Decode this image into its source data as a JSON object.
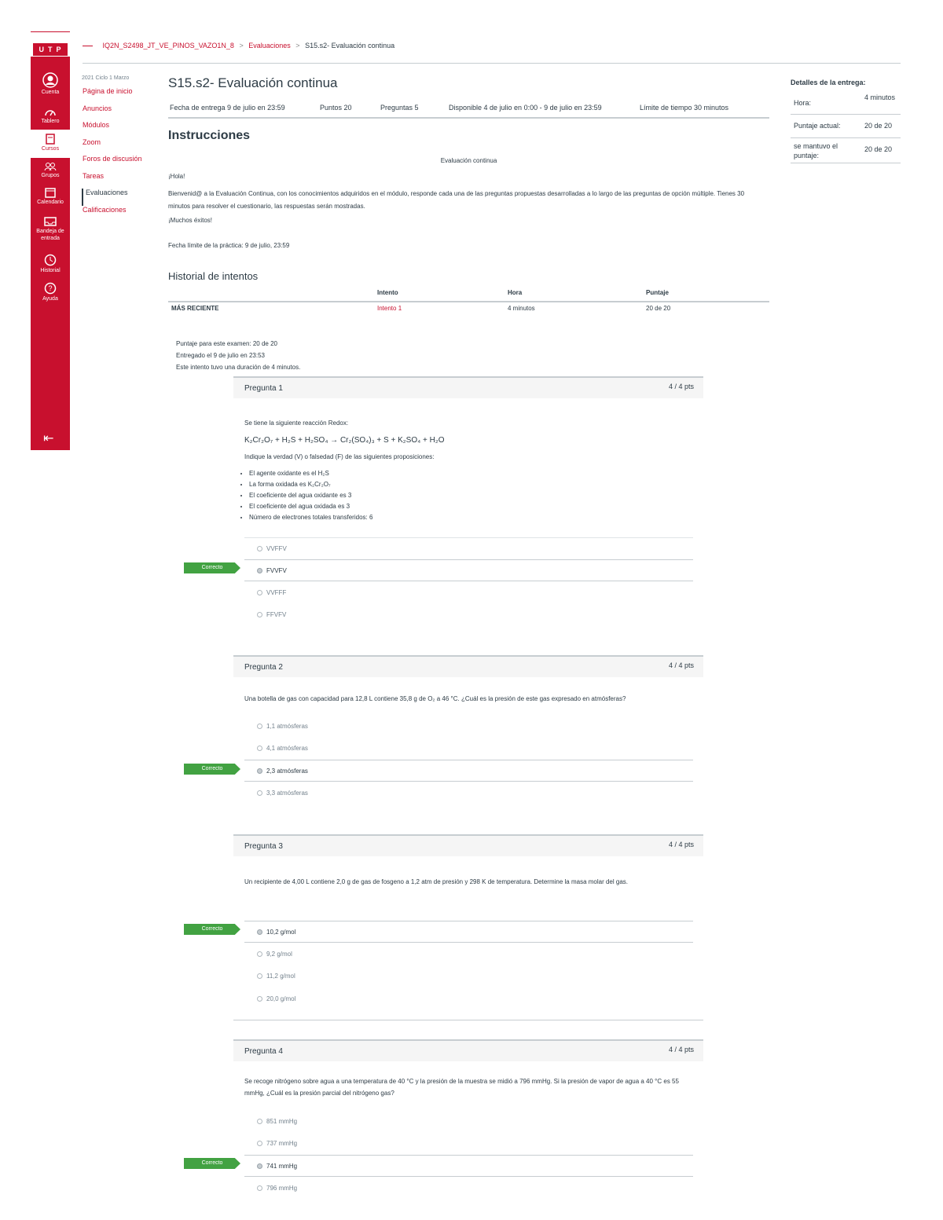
{
  "global_nav": {
    "logo": "UTP",
    "items": [
      {
        "label": "Cuenta",
        "icon": "account-icon"
      },
      {
        "label": "Tablero",
        "icon": "dashboard-icon"
      },
      {
        "label": "Cursos",
        "icon": "courses-icon"
      },
      {
        "label": "Grupos",
        "icon": "groups-icon"
      },
      {
        "label": "Calendario",
        "icon": "calendar-icon"
      },
      {
        "label": "Bandeja de entrada",
        "icon": "inbox-icon"
      },
      {
        "label": "Historial",
        "icon": "history-icon"
      },
      {
        "label": "Ayuda",
        "icon": "help-icon"
      }
    ]
  },
  "breadcrumb": {
    "course": "IQ2N_S2498_JT_VE_PINOS_VAZO1N_8",
    "section": "Evaluaciones",
    "current": "S15.s2- Evaluación continua"
  },
  "course_nav": {
    "term": "2021 Ciclo 1 Marzo",
    "items": [
      "Página de inicio",
      "Anuncios",
      "Módulos",
      "Zoom",
      "Foros de discusión",
      "Tareas",
      "Evaluaciones",
      "Calificaciones"
    ]
  },
  "quiz": {
    "title": "S15.s2- Evaluación continua",
    "meta": {
      "due": "Fecha de entrega 9 de julio en 23:59",
      "points": "Puntos 20",
      "questions": "Preguntas 5",
      "available": "Disponible 4 de julio en 0:00 - 9 de julio en 23:59",
      "time_limit": "Límite de tiempo 30 minutos"
    },
    "instructions_heading": "Instrucciones",
    "instructions_center": "Evaluación continua",
    "instructions_greeting": "¡Hola!",
    "instructions_body": "Bienvenid@ a la Evaluación Continua, con los conocimientos adquiridos en el módulo, responde cada una de las preguntas propuestas desarrolladas a lo largo de las preguntas de opción múltiple. Tienes 30 minutos para resolver el cuestionario, las respuestas serán mostradas.",
    "instructions_thanks": "¡Muchos éxitos!",
    "instructions_due": "Fecha límite de la práctica: 9 de julio, 23:59"
  },
  "history": {
    "heading": "Historial de intentos",
    "columns": [
      "Intento",
      "Hora",
      "Puntaje"
    ],
    "row": {
      "label": "MÁS RECIENTE",
      "attempt": "Intento 1",
      "time": "4 minutos",
      "score": "20 de 20"
    },
    "summary": [
      "Puntaje para este examen: 20 de 20",
      "Entregado el 9 de julio en 23:53",
      "Este intento tuvo una duración de 4 minutos."
    ]
  },
  "sidebar": {
    "title": "Detalles de la entrega:",
    "rows": [
      {
        "label": "Hora:",
        "value": "4 minutos"
      },
      {
        "label": "Puntaje actual:",
        "value": "20 de 20"
      },
      {
        "label": "se mantuvo el puntaje:",
        "value": "20 de 20"
      }
    ]
  },
  "questions": [
    {
      "title": "Pregunta 1",
      "points": "4 / 4 pts",
      "intro": "Se tiene la siguiente reacción Redox:",
      "equation": "K₂Cr₂O₇ + H₂S + H₂SO₄ → Cr₂(SO₄)₃ + S + K₂SO₄ + H₂O",
      "prompt": "Indique la verdad (V) o falsedad (F) de las siguientes proposiciones:",
      "bullets": [
        "El agente oxidante es el H₂S",
        "La forma oxidada es K₂Cr₂O₇",
        "El coeficiente del agua oxidante es 3",
        "El coeficiente del agua oxidada es 3",
        "Número de electrones totales transferidos: 6"
      ],
      "answers": [
        "VVFFV",
        "FVVFV",
        "VVFFF",
        "FFVFV"
      ],
      "selected": 1,
      "flag": "Correcto"
    },
    {
      "title": "Pregunta 2",
      "points": "4 / 4 pts",
      "prompt": "Una botella de gas con capacidad para 12,8 L contiene 35,8 g de O₂ a 46 °C. ¿Cuál es la presión de este gas expresado en atmósferas?",
      "answers": [
        "1,1 atmósferas",
        "4,1 atmósferas",
        "2,3 atmósferas",
        "3,3 atmósferas"
      ],
      "selected": 2,
      "flag": "Correcto"
    },
    {
      "title": "Pregunta 3",
      "points": "4 / 4 pts",
      "prompt": "Un recipiente de 4,00 L contiene 2,0 g de gas de fosgeno a 1,2 atm de presión y 298 K de temperatura. Determine la masa molar del gas.",
      "answers": [
        "10,2 g/mol",
        "9,2 g/mol",
        "11,2 g/mol",
        "20,0 g/mol"
      ],
      "selected": 0,
      "flag": "Correcto"
    },
    {
      "title": "Pregunta 4",
      "points": "4 / 4 pts",
      "prompt": "Se recoge nitrógeno sobre agua a una temperatura de 40 °C y la presión de la muestra se midió a 796 mmHg. Si la presión de vapor de agua a 40 °C es 55 mmHg, ¿Cuál es la presión parcial del nitrógeno gas?",
      "answers": [
        "851 mmHg",
        "737 mmHg",
        "741 mmHg",
        "796 mmHg"
      ],
      "selected": 2,
      "flag": "Correcto"
    }
  ]
}
